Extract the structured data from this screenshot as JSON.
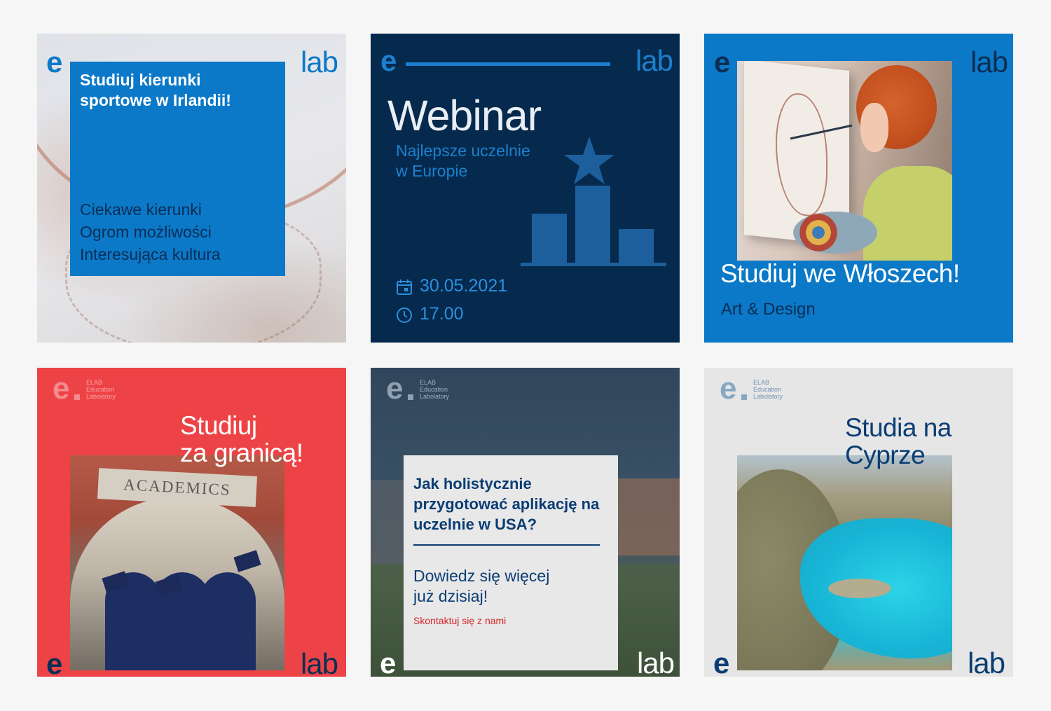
{
  "colors": {
    "brand_blue": "#0b79c8",
    "navy": "#062a4d",
    "red": "#ee4346",
    "dark_blue_text": "#0b3d74",
    "contact_red": "#d3272b",
    "page_bg": "#f6f6f6"
  },
  "logo": {
    "e": "e",
    "lab": "lab",
    "small_e": "e",
    "small_text": [
      "ELAB",
      "Education",
      "Labolatory"
    ]
  },
  "tiles": {
    "ireland": {
      "title": "Studiuj kierunki sportowe w Irlandii!",
      "lines": [
        "Ciekawe kierunki",
        "Ogrom możliwości",
        "Interesująca kultura"
      ]
    },
    "webinar": {
      "title": "Webinar",
      "subtitle_lines": [
        "Najlepsze uczelnie",
        "w Europie"
      ],
      "date": "30.05.2021",
      "time": "17.00",
      "icons": [
        "calendar-icon",
        "clock-icon",
        "podium-star-icon"
      ]
    },
    "italy": {
      "title": "Studiuj we Włoszech!",
      "subtitle": "Art & Design"
    },
    "abroad": {
      "title_lines": [
        "Studiuj",
        "za granicą!"
      ],
      "photo_sign": "ACADEMICS"
    },
    "usa": {
      "question": "Jak holistycznie przygotować aplikację na uczelnie w USA?",
      "more_lines": [
        "Dowiedz się więcej",
        "już dzisiaj!"
      ],
      "contact": "Skontaktuj się z nami"
    },
    "cyprus": {
      "title_lines": [
        "Studia na",
        "Cyprze"
      ]
    }
  }
}
